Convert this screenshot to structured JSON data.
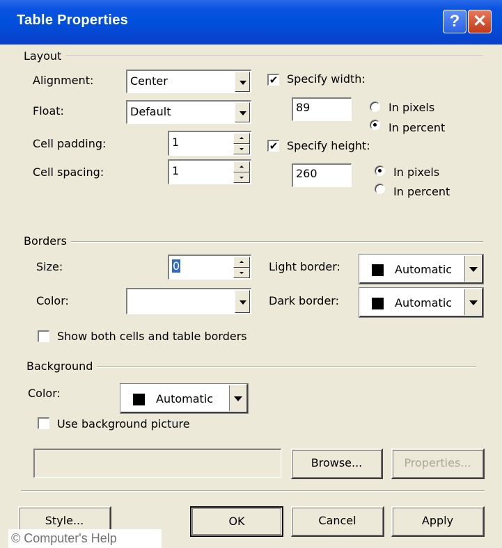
{
  "window": {
    "title": "Table Properties",
    "help_glyph": "?",
    "close_glyph": "✕"
  },
  "layout": {
    "label": "Layout",
    "alignment": {
      "label": "Alignment:",
      "value": "Center"
    },
    "float": {
      "label": "Float:",
      "value": "Default"
    },
    "cell_padding": {
      "label": "Cell padding:",
      "value": "1"
    },
    "cell_spacing": {
      "label": "Cell spacing:",
      "value": "1"
    },
    "specify_width": {
      "label": "Specify width:",
      "checked": true,
      "value": "89",
      "option_pixels": "In pixels",
      "option_percent": "In percent",
      "selected": "In percent"
    },
    "specify_height": {
      "label": "Specify height:",
      "checked": true,
      "value": "260",
      "option_pixels": "In pixels",
      "option_percent": "In percent",
      "selected": "In pixels"
    }
  },
  "borders": {
    "label": "Borders",
    "size": {
      "label": "Size:",
      "value": "0"
    },
    "color": {
      "label": "Color:",
      "value": ""
    },
    "light_border": {
      "label": "Light border:",
      "value": "Automatic",
      "swatch": "#000000"
    },
    "dark_border": {
      "label": "Dark border:",
      "value": "Automatic",
      "swatch": "#000000"
    },
    "show_both": {
      "label": "Show both cells and table borders",
      "checked": false
    }
  },
  "background": {
    "label": "Background",
    "color": {
      "label": "Color:",
      "value": "Automatic",
      "swatch": "#000000"
    },
    "use_picture": {
      "label": "Use background picture",
      "checked": false
    },
    "picture_path": "",
    "browse_label": "Browse...",
    "properties_label": "Properties..."
  },
  "footer": {
    "style_label": "Style...",
    "ok_label": "OK",
    "cancel_label": "Cancel",
    "apply_label": "Apply"
  },
  "watermark": "© Computer's Help",
  "colors": {
    "titlebar": "#0050dc",
    "dialog_bg": "#ece9d8",
    "close_red": "#c13a1a"
  },
  "checkmark_glyph": "✔"
}
